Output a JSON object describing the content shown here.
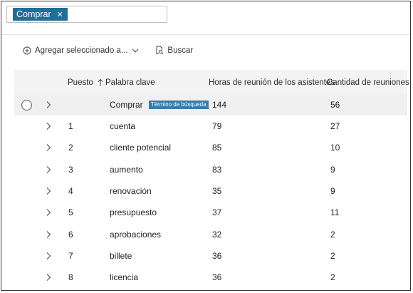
{
  "search": {
    "chip_label": "Comprar",
    "chip_close": "✕",
    "placeholder": ""
  },
  "toolbar": {
    "add_selected_label": "Agregar seleccionado a...",
    "search_label": "Buscar"
  },
  "table": {
    "columns": {
      "rank": "Puesto",
      "keyword": "Palabra clave",
      "hours": "Horas de reunión de los asistentes",
      "count": "Cantidad de reuniones"
    },
    "search_row": {
      "keyword": "Comprar",
      "tag": "Término de búsqueda",
      "hours": "144",
      "count": "56"
    },
    "rows": [
      {
        "rank": "1",
        "keyword": "cuenta",
        "hours": "79",
        "count": "27"
      },
      {
        "rank": "2",
        "keyword": "cliente potencial",
        "hours": "85",
        "count": "10"
      },
      {
        "rank": "3",
        "keyword": "aumento",
        "hours": "83",
        "count": "9"
      },
      {
        "rank": "4",
        "keyword": "renovación",
        "hours": "35",
        "count": "9"
      },
      {
        "rank": "5",
        "keyword": "presupuesto",
        "hours": "37",
        "count": "11"
      },
      {
        "rank": "6",
        "keyword": "aprobaciones",
        "hours": "32",
        "count": "2"
      },
      {
        "rank": "7",
        "keyword": "billete",
        "hours": "36",
        "count": "2"
      },
      {
        "rank": "8",
        "keyword": "licencia",
        "hours": "36",
        "count": "2"
      }
    ]
  },
  "colors": {
    "chip_bg": "#1f6f98",
    "tag_bg": "#3a7ca8",
    "header_bg": "#f3f3f3"
  }
}
